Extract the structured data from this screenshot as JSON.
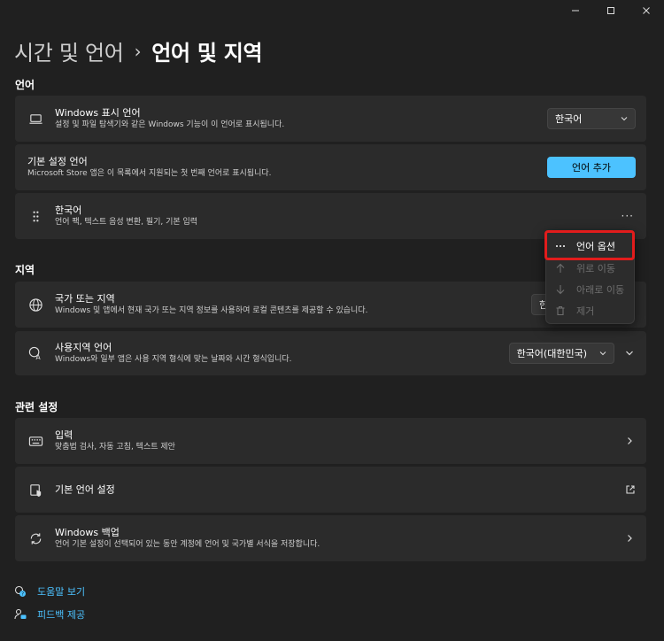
{
  "window": {
    "minimize": "—",
    "maximize": "☐",
    "close": "✕"
  },
  "breadcrumb": {
    "parent": "시간 및 언어",
    "separator": "›",
    "current": "언어 및 지역"
  },
  "sections": {
    "language": "언어",
    "region": "지역",
    "related": "관련 설정"
  },
  "display_language": {
    "title": "Windows 표시 언어",
    "desc": "설정 및 파일 탐색기와 같은 Windows 기능이 이 언어로 표시됩니다.",
    "value": "한국어",
    "icon": "laptop-icon"
  },
  "preferred_language": {
    "title": "기본 설정 언어",
    "desc": "Microsoft Store 앱은 이 목록에서 지원되는 첫 번째 언어로 표시됩니다.",
    "button": "언어 추가"
  },
  "korean_item": {
    "title": "한국어",
    "desc": "언어 팩, 텍스트 음성 변환, 필기, 기본 입력",
    "more": "···",
    "icon": "drag-handle-icon"
  },
  "flyout": {
    "items": [
      {
        "label": "언어 옵션",
        "icon": "more-icon",
        "enabled": true
      },
      {
        "label": "위로 이동",
        "icon": "arrow-up-icon",
        "enabled": false
      },
      {
        "label": "아래로 이동",
        "icon": "arrow-down-icon",
        "enabled": false
      },
      {
        "label": "제거",
        "icon": "trash-icon",
        "enabled": false
      }
    ],
    "highlight_color": "#e21c1c"
  },
  "country": {
    "title": "국가 또는 지역",
    "desc": "Windows 및 앱에서 현재 국가 또는 지역 정보를 사용하여 로컬 콘텐츠를 제공할 수 있습니다.",
    "value": "한",
    "icon": "globe-icon"
  },
  "regional_format": {
    "title": "사용지역 언어",
    "desc": "Windows와 일부 앱은 사용 지역 형식에 맞는 날짜와 시간 형식입니다.",
    "value": "한국어(대한민국)",
    "icon": "regional-format-icon"
  },
  "related": [
    {
      "title": "입력",
      "desc": "맞춤법 검사, 자동 고침, 텍스트 제안",
      "icon": "keyboard-icon"
    },
    {
      "title": "기본 언어 설정",
      "desc": "",
      "icon": "admin-language-icon"
    },
    {
      "title": "Windows 백업",
      "desc": "언어 기본 설정이 선택되어 있는 동안 계정에 언어 및 국가별 서식을 저장합니다.",
      "icon": "backup-icon"
    }
  ],
  "links": {
    "help": "도움말 보기",
    "feedback": "피드백 제공"
  },
  "colors": {
    "accent": "#4cc2ff",
    "background": "#202020",
    "card": "#2b2b2b"
  }
}
